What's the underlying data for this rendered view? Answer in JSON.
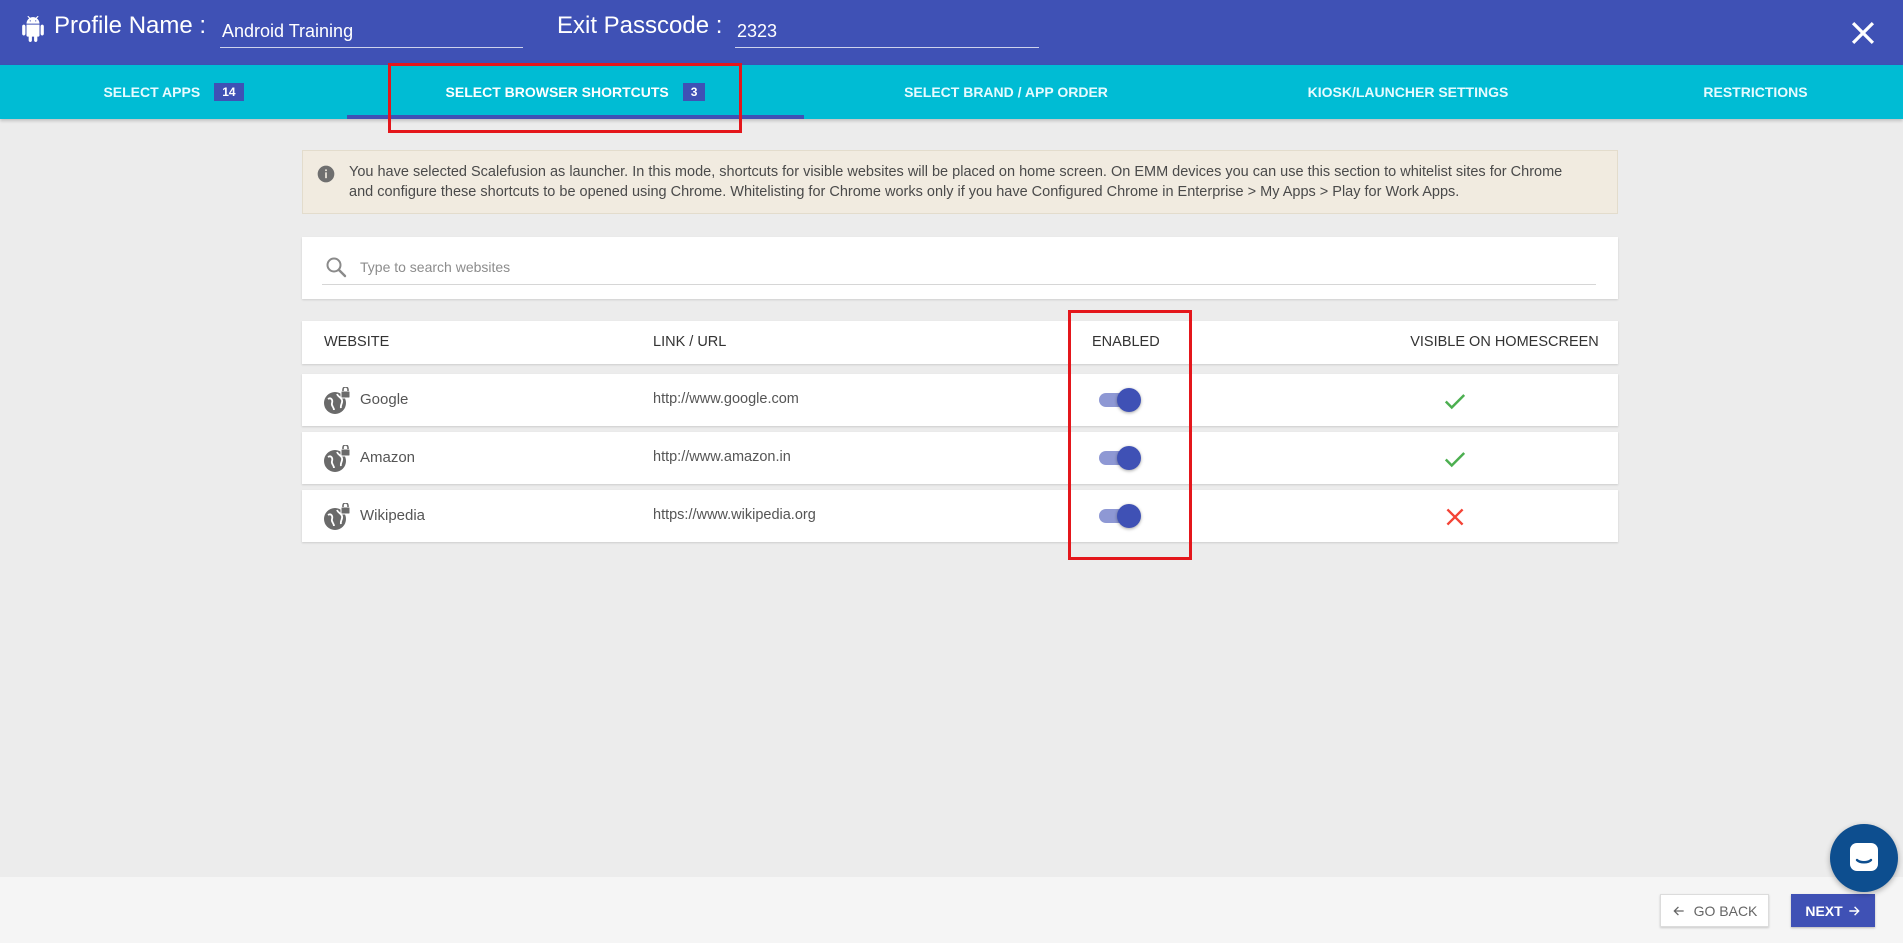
{
  "header": {
    "profile_label": "Profile Name :",
    "profile_value": "Android Training",
    "passcode_label": "Exit Passcode :",
    "passcode_value": "2323",
    "close_icon": "close-icon",
    "brand_icon": "android-icon"
  },
  "tabs": [
    {
      "label": "SELECT APPS",
      "badge": "14",
      "active": false
    },
    {
      "label": "SELECT BROWSER SHORTCUTS",
      "badge": "3",
      "active": true
    },
    {
      "label": "SELECT BRAND / APP ORDER",
      "badge": "",
      "active": false
    },
    {
      "label": "KIOSK/LAUNCHER SETTINGS",
      "badge": "",
      "active": false
    },
    {
      "label": "RESTRICTIONS",
      "badge": "",
      "active": false
    }
  ],
  "info": {
    "icon": "info-icon",
    "line1": "You have selected Scalefusion as launcher. In this mode, shortcuts for visible websites will be placed on home screen. On EMM devices you can use this section to whitelist sites for Chrome",
    "line2": "and configure these shortcuts to be opened using Chrome. Whitelisting for Chrome works only if you have Configured Chrome in Enterprise > My Apps > Play for Work Apps."
  },
  "search": {
    "placeholder": "Type to search websites",
    "value": ""
  },
  "table": {
    "headers": {
      "website": "WEBSITE",
      "link": "LINK / URL",
      "enabled": "ENABLED",
      "visible": "VISIBLE ON HOMESCREEN"
    },
    "rows": [
      {
        "name": "Google",
        "url": "http://www.google.com",
        "enabled": true,
        "visible": true
      },
      {
        "name": "Amazon",
        "url": "http://www.amazon.in",
        "enabled": true,
        "visible": true
      },
      {
        "name": "Wikipedia",
        "url": "https://www.wikipedia.org",
        "enabled": true,
        "visible": false
      }
    ]
  },
  "footer": {
    "back_label": "GO BACK",
    "next_label": "NEXT"
  },
  "colors": {
    "primary": "#3f51b5",
    "tabs_bg": "#00bcd4",
    "highlight": "#e4161b",
    "check": "#4caf50",
    "cross": "#f44336"
  }
}
